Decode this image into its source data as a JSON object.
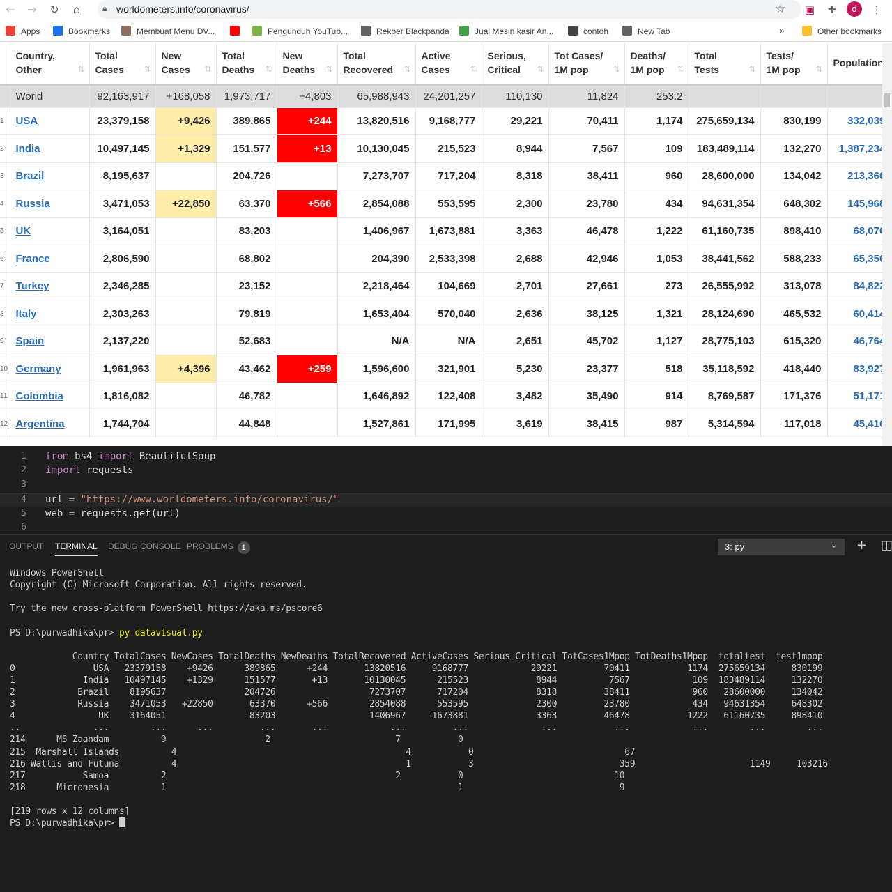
{
  "browser": {
    "url": "worldometers.info/coronavirus/",
    "avatar_letter": "d",
    "bookmarks": [
      {
        "label": "Apps",
        "color": "#ea4335"
      },
      {
        "label": "Bookmarks",
        "color": "#1a73e8"
      },
      {
        "label": "Membuat Menu DV...",
        "color": "#8d6e63"
      },
      {
        "label": "",
        "color": "#ff0000"
      },
      {
        "label": "Pengunduh YouTub...",
        "color": "#7cb342"
      },
      {
        "label": "Rekber Blackpanda",
        "color": "#5f6368"
      },
      {
        "label": "Jual Mesin kasir An...",
        "color": "#43a047"
      },
      {
        "label": "contoh",
        "color": "#424242"
      },
      {
        "label": "New Tab",
        "color": "#5f6368"
      }
    ],
    "overflow_label": "»",
    "other_bookmarks": "Other bookmarks"
  },
  "table": {
    "headers": [
      [
        "Country,",
        "Other"
      ],
      [
        "Total",
        "Cases"
      ],
      [
        "New",
        "Cases"
      ],
      [
        "Total",
        "Deaths"
      ],
      [
        "New",
        "Deaths"
      ],
      [
        "Total",
        "Recovered"
      ],
      [
        "Active",
        "Cases"
      ],
      [
        "Serious,",
        "Critical"
      ],
      [
        "Tot Cases/",
        "1M pop"
      ],
      [
        "Deaths/",
        "1M pop"
      ],
      [
        "Total",
        "Tests"
      ],
      [
        "Tests/",
        "1M pop"
      ],
      [
        "Population",
        ""
      ]
    ],
    "world": [
      "World",
      "92,163,917",
      "+168,058",
      "1,973,717",
      "+4,803",
      "65,988,943",
      "24,201,257",
      "110,130",
      "11,824",
      "253.2",
      "",
      "",
      ""
    ],
    "rows": [
      {
        "n": "1",
        "cells": [
          "USA",
          "23,379,158",
          "+9,426",
          "389,865",
          "+244",
          "13,820,516",
          "9,168,777",
          "29,221",
          "70,411",
          "1,174",
          "275,659,134",
          "830,199",
          "332,039,"
        ]
      },
      {
        "n": "2",
        "cells": [
          "India",
          "10,497,145",
          "+1,329",
          "151,577",
          "+13",
          "10,130,045",
          "215,523",
          "8,944",
          "7,567",
          "109",
          "183,489,114",
          "132,270",
          "1,387,234,"
        ]
      },
      {
        "n": "3",
        "cells": [
          "Brazil",
          "8,195,637",
          "",
          "204,726",
          "",
          "7,273,707",
          "717,204",
          "8,318",
          "38,411",
          "960",
          "28,600,000",
          "134,042",
          "213,366,"
        ]
      },
      {
        "n": "4",
        "cells": [
          "Russia",
          "3,471,053",
          "+22,850",
          "63,370",
          "+566",
          "2,854,088",
          "553,595",
          "2,300",
          "23,780",
          "434",
          "94,631,354",
          "648,302",
          "145,968,"
        ]
      },
      {
        "n": "5",
        "cells": [
          "UK",
          "3,164,051",
          "",
          "83,203",
          "",
          "1,406,967",
          "1,673,881",
          "3,363",
          "46,478",
          "1,222",
          "61,160,735",
          "898,410",
          "68,076,"
        ]
      },
      {
        "n": "6",
        "cells": [
          "France",
          "2,806,590",
          "",
          "68,802",
          "",
          "204,390",
          "2,533,398",
          "2,688",
          "42,946",
          "1,053",
          "38,441,562",
          "588,233",
          "65,350,"
        ]
      },
      {
        "n": "7",
        "cells": [
          "Turkey",
          "2,346,285",
          "",
          "23,152",
          "",
          "2,218,464",
          "104,669",
          "2,701",
          "27,661",
          "273",
          "26,555,992",
          "313,078",
          "84,822,"
        ]
      },
      {
        "n": "8",
        "cells": [
          "Italy",
          "2,303,263",
          "",
          "79,819",
          "",
          "1,653,404",
          "570,040",
          "2,636",
          "38,125",
          "1,321",
          "28,124,690",
          "465,532",
          "60,414,"
        ]
      },
      {
        "n": "9",
        "cells": [
          "Spain",
          "2,137,220",
          "",
          "52,683",
          "",
          "N/A",
          "N/A",
          "2,651",
          "45,702",
          "1,127",
          "28,775,103",
          "615,320",
          "46,764,"
        ]
      },
      {
        "n": "10",
        "cells": [
          "Germany",
          "1,961,963",
          "+4,396",
          "43,462",
          "+259",
          "1,596,600",
          "321,901",
          "5,230",
          "23,377",
          "518",
          "35,118,592",
          "418,440",
          "83,927,"
        ]
      },
      {
        "n": "11",
        "cells": [
          "Colombia",
          "1,816,082",
          "",
          "46,782",
          "",
          "1,646,892",
          "122,408",
          "3,482",
          "35,490",
          "914",
          "8,769,587",
          "171,376",
          "51,171,"
        ]
      },
      {
        "n": "12",
        "cells": [
          "Argentina",
          "1,744,704",
          "",
          "44,848",
          "",
          "1,527,861",
          "171,995",
          "3,619",
          "38,415",
          "987",
          "5,314,594",
          "117,018",
          "45,416,"
        ]
      }
    ]
  },
  "editor": {
    "lines": [
      {
        "n": "1",
        "parts": [
          [
            "kw",
            "from"
          ],
          [
            "",
            " bs4 "
          ],
          [
            "kw",
            "import"
          ],
          [
            "",
            " BeautifulSoup"
          ]
        ]
      },
      {
        "n": "2",
        "parts": [
          [
            "kw",
            "import"
          ],
          [
            "",
            " requests"
          ]
        ]
      },
      {
        "n": "3",
        "parts": []
      },
      {
        "n": "4",
        "parts": [
          [
            "",
            "url = "
          ],
          [
            "str",
            "\"https://www.worldometers.info/coronavirus/\""
          ]
        ]
      },
      {
        "n": "5",
        "parts": [
          [
            "",
            "web = requests.get(url)"
          ]
        ]
      },
      {
        "n": "6",
        "parts": []
      }
    ]
  },
  "panel": {
    "tabs": [
      "OUTPUT",
      "TERMINAL",
      "DEBUG CONSOLE",
      "PROBLEMS"
    ],
    "problems_count": "1",
    "terminal_select": "3: py",
    "plus": "+",
    "split": "◫"
  },
  "terminal": {
    "lines": [
      "Windows PowerShell",
      "Copyright (C) Microsoft Corporation. All rights reserved.",
      "",
      "Try the new cross-platform PowerShell https://aka.ms/pscore6",
      "",
      "",
      "            Country TotalCases NewCases TotalDeaths NewDeaths TotalRecovered ActiveCases Serious_Critical TotCases1Mpop TotDeaths1Mpop  totaltest  test1mpop",
      "0               USA   23379158    +9426      389865      +244       13820516     9168777            29221         70411           1174  275659134     830199",
      "1             India   10497145    +1329      151577       +13       10130045      215523             8944          7567            109  183489114     132270",
      "2            Brazil    8195637               204726                  7273707      717204             8318         38411            960   28600000     134042",
      "3            Russia    3471053   +22850       63370      +566        2854088      553595             2300         23780            434   94631354     648302",
      "4                UK    3164051                83203                  1406967     1673881             3363         46478           1222   61160735     898410",
      "..              ...        ...      ...         ...       ...            ...         ...              ...           ...            ...        ...        ...",
      "214      MS Zaandam          9                   2                        7           0",
      "215  Marshall Islands          4                                            4           0                             67",
      "216 Wallis and Futuna          4                                            1           3                            359                      1149     103216",
      "217           Samoa          2                                            2           0                             10",
      "218      Micronesia          1                                                        1                              9",
      "",
      "[219 rows x 12 columns]"
    ],
    "prompt1": "PS D:\\purwadhika\\pr> ",
    "command": "py datavisual.py",
    "prompt2": "PS D:\\purwadhika\\pr> "
  }
}
